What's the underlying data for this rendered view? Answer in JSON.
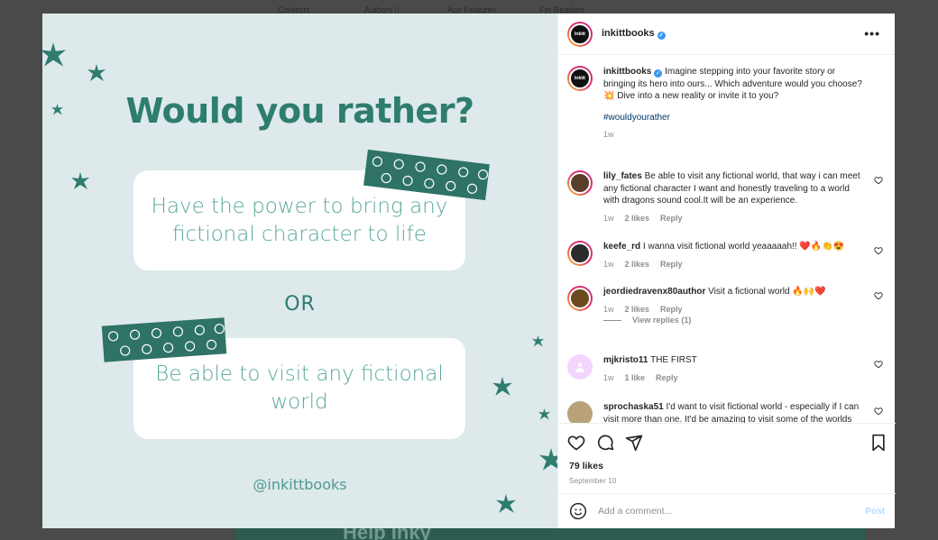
{
  "background_nav": [
    "Contests",
    "Authors ▯",
    "App Features",
    "For Readers"
  ],
  "background_banner": "Help Inky",
  "post": {
    "title": "Would you rather?",
    "option_1": "Have the power to bring any fictional character to life",
    "or": "OR",
    "option_2": "Be able to visit any fictional world",
    "handle": "@inkittbooks"
  },
  "header": {
    "avatar_text": "Inkitt",
    "username": "inkittbooks",
    "verified_mark": "✓",
    "more": "•••"
  },
  "caption": {
    "username": "inkittbooks",
    "text": "Imagine stepping into your favorite story or bringing its hero into ours... Which adventure would you choose? 💥 Dive into a new reality or invite it to you?",
    "hashtag": "#wouldyourather",
    "time": "1w"
  },
  "comments": [
    {
      "user": "lily_fates",
      "text": "Be able to visit any fictional world, that way i can meet any fictional character I want and honestly traveling to a world with dragons sound cool.It will be an experience.",
      "time": "1w",
      "likes": "2 likes",
      "reply": "Reply"
    },
    {
      "user": "keefe_rd",
      "text": "I wanna visit fictional world yeaaaaah!! ❤️🔥👏😍",
      "time": "1w",
      "likes": "2 likes",
      "reply": "Reply"
    },
    {
      "user": "jeordiedravenx80author",
      "text": "Visit a fictional world 🔥🙌❤️",
      "time": "1w",
      "likes": "2 likes",
      "reply": "Reply"
    },
    {
      "user": "mjkristo11",
      "text": "THE FIRST",
      "time": "1w",
      "likes": "1 like",
      "reply": "Reply"
    },
    {
      "user": "sprochaska51",
      "text": "I'd want to visit fictional world - especially if I can visit more than one. It'd be amazing to visit some of the worlds I've read about.",
      "time": "",
      "likes": "",
      "reply": ""
    }
  ],
  "view_replies": "View replies (1)",
  "likes_count": "79 likes",
  "date": "September 10",
  "add_comment": {
    "placeholder": "Add a comment...",
    "post_label": "Post"
  },
  "icons": [
    "heart-icon",
    "comment-icon",
    "share-icon",
    "bookmark-icon",
    "emoji-icon",
    "more-icon",
    "verified-icon"
  ],
  "colors": {
    "accent": "#2e7d6f",
    "post_bg": "#dde9ea",
    "link": "#00376b",
    "post_btn": "#b3dbff"
  }
}
